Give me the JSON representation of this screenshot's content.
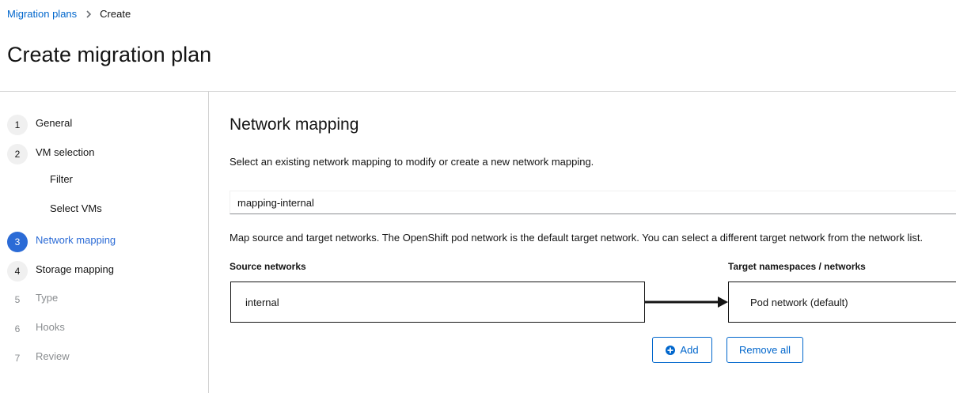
{
  "breadcrumb": {
    "parent": "Migration plans",
    "current": "Create"
  },
  "page": {
    "title": "Create migration plan"
  },
  "wizard": {
    "steps": [
      {
        "number": "1",
        "label": "General"
      },
      {
        "number": "2",
        "label": "VM selection"
      },
      {
        "number": "3",
        "label": "Network mapping"
      },
      {
        "number": "4",
        "label": "Storage mapping"
      },
      {
        "number": "5",
        "label": "Type"
      },
      {
        "number": "6",
        "label": "Hooks"
      },
      {
        "number": "7",
        "label": "Review"
      }
    ],
    "substeps": [
      "Filter",
      "Select VMs"
    ],
    "current_step": "3"
  },
  "main": {
    "title": "Network mapping",
    "intro": "Select an existing network mapping to modify or create a new network mapping.",
    "selected_mapping": "mapping-internal",
    "help": "Map source and target networks. The OpenShift pod network is the default target network. You can select a different target network from the network list.",
    "source_header": "Source networks",
    "target_header": "Target namespaces / networks",
    "mappings": [
      {
        "source": "internal",
        "target": "Pod network (default)"
      }
    ],
    "add_label": "Add",
    "remove_all_label": "Remove all"
  },
  "colors": {
    "accent": "#0066cc",
    "current_step": "#2b6bd6",
    "border": "#d2d2d2"
  }
}
